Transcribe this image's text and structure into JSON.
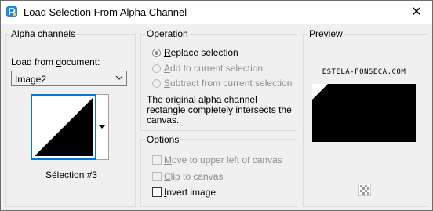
{
  "window": {
    "title": "Load Selection From Alpha Channel",
    "close_glyph": "✕",
    "icon": "paintshop-pro-icon"
  },
  "alpha_channels": {
    "group_label": "Alpha channels",
    "load_label_prefix": "Load from ",
    "load_label_underlined": "d",
    "load_label_suffix": "ocument:",
    "document_value": "Image2",
    "selection_name": "Sélection #3"
  },
  "operation": {
    "group_label": "Operation",
    "options": [
      {
        "mnemonic": "R",
        "rest": "eplace selection",
        "selected": true,
        "enabled": true
      },
      {
        "mnemonic": "A",
        "rest": "dd to current selection",
        "selected": false,
        "enabled": false
      },
      {
        "mnemonic": "S",
        "rest": "ubtract from current selection",
        "selected": false,
        "enabled": false
      }
    ],
    "note_line1": "The original alpha channel",
    "note_line2": "rectangle completely intersects the",
    "note_line3": "canvas."
  },
  "options": {
    "group_label": "Options",
    "items": [
      {
        "mnemonic": "M",
        "rest": "ove to upper left of canvas",
        "checked": false,
        "enabled": false
      },
      {
        "mnemonic": "C",
        "rest": "lip to canvas",
        "checked": false,
        "enabled": false
      },
      {
        "mnemonic": "I",
        "rest": "nvert image",
        "checked": false,
        "enabled": true
      }
    ]
  },
  "preview": {
    "group_label": "Preview",
    "watermark": "ESTELA-FONSECA.COM"
  },
  "colors": {
    "accent": "#0078d7",
    "background": "#f0f0f0",
    "group_border": "#dcdcdc",
    "disabled_text": "#8d8d8d"
  }
}
